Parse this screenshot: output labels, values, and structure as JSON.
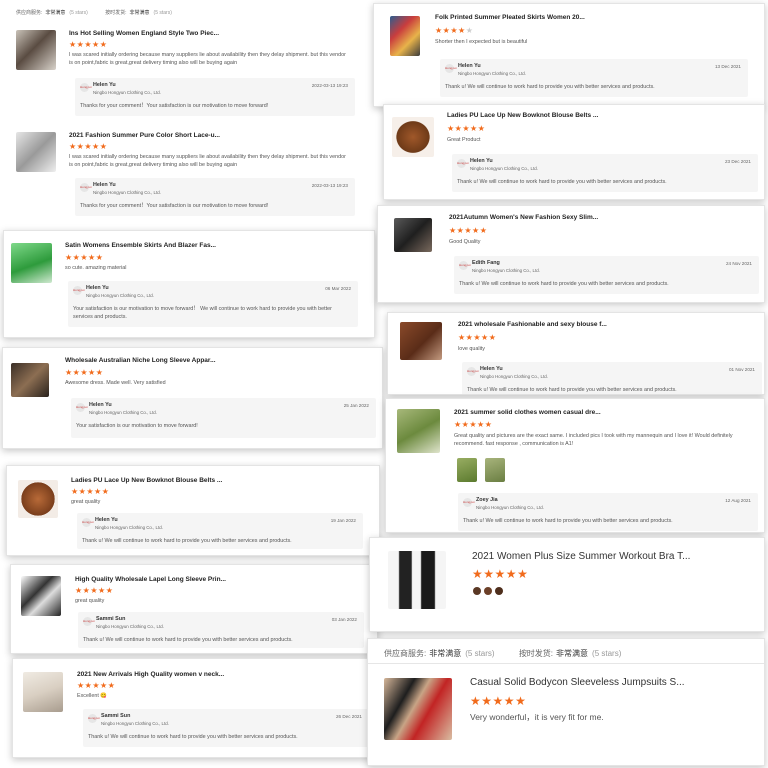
{
  "header_small": {
    "service_label": "供应商服务:",
    "service_value": "非常满意",
    "service_stars": "(5 stars)",
    "ship_label": "按时发货:",
    "ship_value": "非常满意",
    "ship_stars": "(5 stars)"
  },
  "header_large": {
    "service_label": "供应商服务:",
    "service_value": "非常满意",
    "service_stars": "(5 stars)",
    "ship_label": "按时发货:",
    "ship_value": "非常满意",
    "ship_stars": "(5 stars)"
  },
  "star_glyph": "★",
  "seller_logo_text": "Hongyun",
  "colors": {
    "star": "#f16b1c",
    "star_off": "#cccccc",
    "reply_bg": "#f5f5f5"
  },
  "reviews": [
    {
      "id": "r1",
      "title": "Ins Hot Selling Women England Style Two Piec...",
      "rating": 5,
      "text": "I was scared initially ordering because many suppliers lie about availability then they delay shipment. but this vendor is on point,fabric is great,great delivery timing also will be buying again",
      "reply": {
        "name": "Helen Yu",
        "company": "Ningbo Hongyun Clothing Co., Ltd.",
        "date": "2022-03-13 19:23",
        "message": "Thanks for your comment！Your satisfaction is our motivation to move forward!"
      }
    },
    {
      "id": "r2",
      "title": "2021 Fashion Summer Pure Color Short Lace-u...",
      "rating": 5,
      "text": "I was scared initially ordering because many suppliers lie about availability then they delay shipment. but this vendor is on point,fabric is great,great delivery timing also will be buying again",
      "reply": {
        "name": "Helen Yu",
        "company": "Ningbo Hongyun Clothing Co., Ltd.",
        "date": "2022-03-13 19:23",
        "message": "Thanks for your comment！Your satisfaction is our motivation to move forward!"
      }
    },
    {
      "id": "r3",
      "title": "Satin Womens Ensemble Skirts And Blazer Fas...",
      "rating": 5,
      "text": "so cute. amazing material",
      "reply": {
        "name": "Helen Yu",
        "company": "Ningbo Hongyun Clothing Co., Ltd.",
        "date": "06 Mar 2022",
        "message": "Your satisfaction is our motivation to move forward！ We will continue to work hard to provide you with better services and products."
      }
    },
    {
      "id": "r4",
      "title": "Wholesale Australian Niche Long Sleeve Appar...",
      "rating": 5,
      "text": "Awesome dress. Made well. Very satisfied",
      "reply": {
        "name": "Helen Yu",
        "company": "Ningbo Hongyun Clothing Co., Ltd.",
        "date": "25 Jan 2022",
        "message": "Your satisfaction is our motivation to move forward!"
      }
    },
    {
      "id": "r5",
      "title": "Ladies PU Lace Up New Bowknot Blouse Belts ...",
      "rating": 5,
      "text": "great quality",
      "reply": {
        "name": "Helen Yu",
        "company": "Ningbo Hongyun Clothing Co., Ltd.",
        "date": "19 Jan 2022",
        "message": "Thank u!   We will continue to work hard to provide you with better services and products."
      }
    },
    {
      "id": "r6",
      "title": "High Quality Wholesale Lapel Long Sleeve Prin...",
      "rating": 5,
      "text": "great quality",
      "reply": {
        "name": "Sammi Sun",
        "company": "Ningbo Hongyun Clothing Co., Ltd.",
        "date": "03 Jan 2022",
        "message": "Thank u!   We will continue to work hard to provide you with better services and products."
      }
    },
    {
      "id": "r7",
      "title": "2021 New Arrivals High Quality women v neck...",
      "rating": 5,
      "text": "Excellent 😋",
      "reply": {
        "name": "Sammi Sun",
        "company": "Ningbo Hongyun Clothing Co., Ltd.",
        "date": "26 Dec 2021",
        "message": "Thank u!   We will continue to work hard to provide you with better services and products."
      }
    },
    {
      "id": "r8",
      "title": "Folk Printed Summer Pleated Skirts Women 20...",
      "rating": 4,
      "text": "Shorter then I expected but is beautiful",
      "reply": {
        "name": "Helen Yu",
        "company": "Ningbo Hongyun Clothing Co., Ltd.",
        "date": "13 Dec 2021",
        "message": "Thank u!   We will continue to work hard to provide you with better services and products."
      }
    },
    {
      "id": "r9",
      "title": "Ladies PU Lace Up New Bowknot Blouse Belts ...",
      "rating": 5,
      "text": "Great Product",
      "reply": {
        "name": "Helen Yu",
        "company": "Ningbo Hongyun Clothing Co., Ltd.",
        "date": "23 Dec 2021",
        "message": "Thank u!   We will continue to work hard to provide you with better services and products."
      }
    },
    {
      "id": "r10",
      "title": "2021Autumn Women's New Fashion Sexy Slim...",
      "rating": 5,
      "text": "Good Quality",
      "reply": {
        "name": "Edith Fang",
        "company": "Ningbo Hongyun Clothing Co., Ltd.",
        "date": "24 Nov 2021",
        "message": "Thank u!   We will continue to work hard to provide you with better services and products."
      }
    },
    {
      "id": "r11",
      "title": "2021 wholesale Fashionable and sexy blouse f...",
      "rating": 5,
      "text": "love quality",
      "reply": {
        "name": "Helen Yu",
        "company": "Ningbo Hongyun Clothing Co., Ltd.",
        "date": "01 Nov 2021",
        "message": "Thank u!   We will continue to work hard to provide you with better services and products."
      }
    },
    {
      "id": "r12",
      "title": "2021 summer solid clothes women casual dre...",
      "rating": 5,
      "text": "Great quality and pictures are the exact same. I included pics I took with my mannequin and I love it! Would definitely recommend. fast response , communication is A1!",
      "reply": {
        "name": "Zoey Jia",
        "company": "Ningbo Hongyun Clothing Co., Ltd.",
        "date": "12 Aug 2021",
        "message": "Thank u!   We will continue to work hard to provide you with better services and products."
      }
    },
    {
      "id": "r13",
      "title": "2021 Women Plus Size Summer Workout Bra T...",
      "rating": 5
    },
    {
      "id": "r14",
      "title": "Casual Solid Bodycon Sleeveless Jumpsuits S...",
      "rating": 5,
      "text": "Very wonderful，it is very fit for me."
    }
  ]
}
